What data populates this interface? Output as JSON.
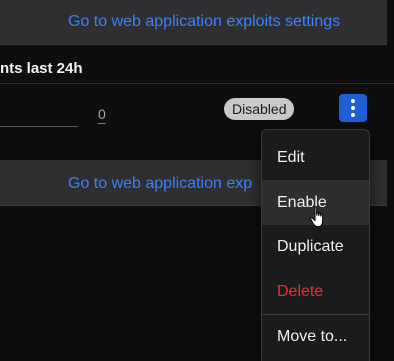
{
  "top_bar": {
    "link_label": "Go to web application exploits settings"
  },
  "section": {
    "events_heading": "nts last 24h"
  },
  "row": {
    "count_value": "0",
    "status": "Disabled"
  },
  "mid_bar": {
    "link_label": "Go to web application exp"
  },
  "menu": {
    "items": [
      {
        "label": "Edit"
      },
      {
        "label": "Enable"
      },
      {
        "label": "Duplicate"
      },
      {
        "label": "Delete"
      },
      {
        "label": "Move to..."
      }
    ]
  },
  "colors": {
    "link": "#3b82f6",
    "accent_button": "#1f5fd6",
    "danger": "#e5322d",
    "badge_bg": "#c9c9cc"
  },
  "icons": {
    "kebab": "more-vertical-icon",
    "cursor": "hand-pointer-cursor-icon"
  }
}
